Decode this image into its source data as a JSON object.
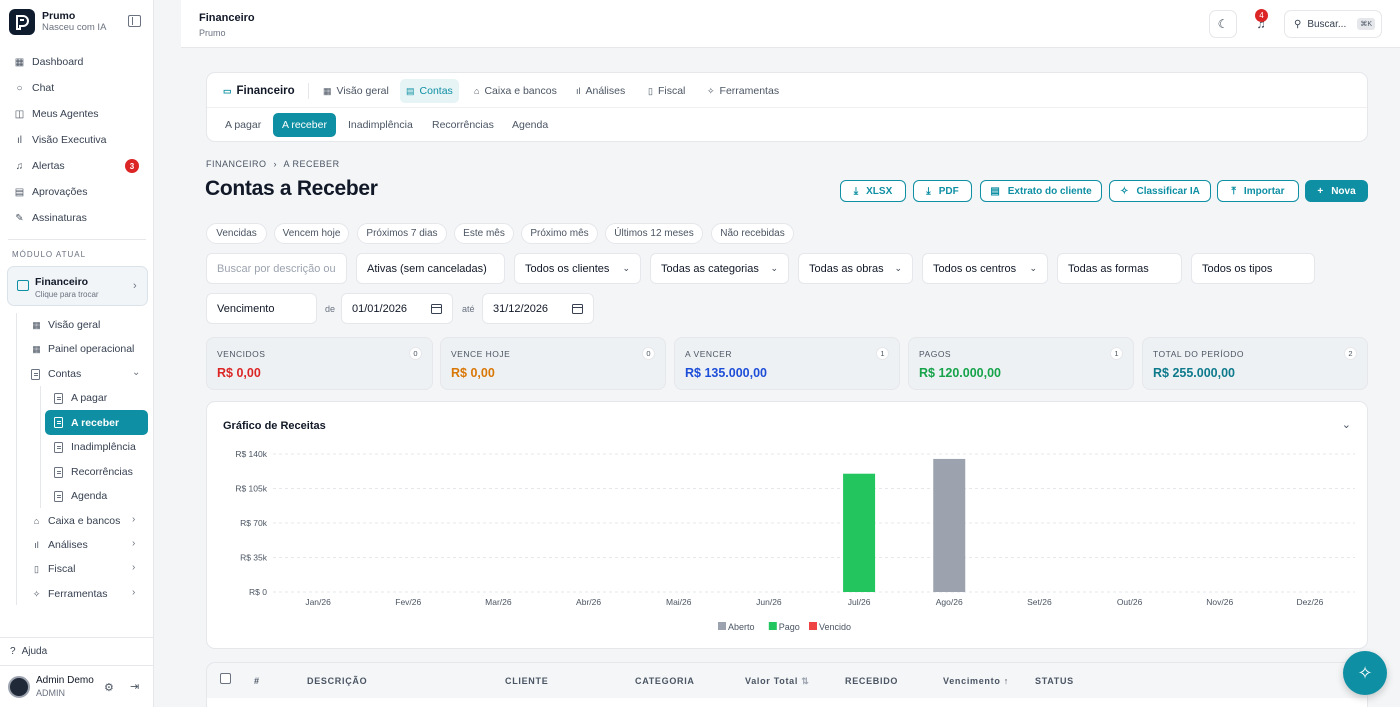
{
  "brand": {
    "name": "Prumo",
    "tagline": "Nasceu com IA"
  },
  "sidebar": {
    "items": [
      {
        "label": "Dashboard",
        "icon": "grid-icon"
      },
      {
        "label": "Chat",
        "icon": "chat-icon"
      },
      {
        "label": "Meus Agentes",
        "icon": "bot-icon"
      },
      {
        "label": "Visão Executiva",
        "icon": "bar-chart-icon"
      },
      {
        "label": "Alertas",
        "icon": "bell-icon",
        "badge": "3"
      },
      {
        "label": "Aprovações",
        "icon": "clipboard-icon"
      },
      {
        "label": "Assinaturas",
        "icon": "pen-icon"
      }
    ],
    "module_label": "MÓDULO ATUAL",
    "module": {
      "title": "Financeiro",
      "subtitle": "Clique para trocar"
    },
    "subnav": {
      "visao_geral": "Visão geral",
      "painel": "Painel operacional",
      "contas": "Contas",
      "contas_children": [
        "A pagar",
        "A receber",
        "Inadimplência",
        "Recorrências",
        "Agenda"
      ],
      "caixa": "Caixa e bancos",
      "analises": "Análises",
      "fiscal": "Fiscal",
      "ferramentas": "Ferramentas"
    },
    "help": "Ajuda",
    "user": {
      "name": "Admin Demo",
      "role": "ADMIN"
    }
  },
  "topbar": {
    "title": "Financeiro",
    "subtitle": "Prumo",
    "notifications": "4",
    "search_placeholder": "Buscar...",
    "shortcut": "⌘K"
  },
  "module_nav": {
    "title": "Financeiro",
    "tabs": [
      "Visão geral",
      "Contas",
      "Caixa e bancos",
      "Análises",
      "Fiscal",
      "Ferramentas"
    ],
    "subtabs": [
      "A pagar",
      "A receber",
      "Inadimplência",
      "Recorrências",
      "Agenda"
    ]
  },
  "breadcrumb": {
    "root": "FINANCEIRO",
    "sep": "›",
    "current": "A RECEBER"
  },
  "page_title": "Contas a Receber",
  "actions": {
    "xlsx": "XLSX",
    "pdf": "PDF",
    "extrato": "Extrato do cliente",
    "classificar": "Classificar IA",
    "importar": "Importar",
    "nova": "Nova"
  },
  "quick_filters": [
    "Vencidas",
    "Vencem hoje",
    "Próximos 7 dias",
    "Este mês",
    "Próximo mês",
    "Últimos 12 meses",
    "Não recebidas"
  ],
  "filters": {
    "search_placeholder": "Buscar por descrição ou",
    "status": "Ativas (sem canceladas)",
    "clientes": "Todos os clientes",
    "categorias": "Todas as categorias",
    "obras": "Todas as obras",
    "centros": "Todos os centros",
    "formas": "Todas as formas",
    "tipos": "Todos os tipos",
    "date_field": "Vencimento",
    "from_label": "de",
    "from": "01/01/2026",
    "to_label": "até",
    "to": "31/12/2026"
  },
  "stats": [
    {
      "label": "VENCIDOS",
      "value": "R$ 0,00",
      "count": "0",
      "color": "#dc2626"
    },
    {
      "label": "VENCE HOJE",
      "value": "R$ 0,00",
      "count": "0",
      "color": "#d97706"
    },
    {
      "label": "A VENCER",
      "value": "R$ 135.000,00",
      "count": "1",
      "color": "#1d4ed8"
    },
    {
      "label": "PAGOS",
      "value": "R$ 120.000,00",
      "count": "1",
      "color": "#16a34a"
    },
    {
      "label": "TOTAL DO PERÍODO",
      "value": "R$ 255.000,00",
      "count": "2",
      "color": "#0e7a8c"
    }
  ],
  "chart_data": {
    "type": "bar",
    "title": "Gráfico de Receitas",
    "categories": [
      "Jan/26",
      "Fev/26",
      "Mar/26",
      "Abr/26",
      "Mai/26",
      "Jun/26",
      "Jul/26",
      "Ago/26",
      "Set/26",
      "Out/26",
      "Nov/26",
      "Dez/26"
    ],
    "series": [
      {
        "name": "Aberto",
        "color": "#9ca3af",
        "values": [
          0,
          0,
          0,
          0,
          0,
          0,
          0,
          135000,
          0,
          0,
          0,
          0
        ]
      },
      {
        "name": "Pago",
        "color": "#22c55e",
        "values": [
          0,
          0,
          0,
          0,
          0,
          0,
          120000,
          0,
          0,
          0,
          0,
          0
        ]
      },
      {
        "name": "Vencido",
        "color": "#ef4444",
        "values": [
          0,
          0,
          0,
          0,
          0,
          0,
          0,
          0,
          0,
          0,
          0,
          0
        ]
      }
    ],
    "yticks": [
      "R$ 0",
      "R$ 35k",
      "R$ 70k",
      "R$ 105k",
      "R$ 140k"
    ],
    "ylim": [
      0,
      140000
    ],
    "grid": true,
    "legend": "bottom"
  },
  "table": {
    "headers": [
      "#",
      "DESCRIÇÃO",
      "CLIENTE",
      "CATEGORIA",
      "Valor Total",
      "RECEBIDO",
      "Vencimento",
      "STATUS"
    ],
    "sort_icon_valor": "⇅",
    "sort_icon_venc": "↑"
  }
}
